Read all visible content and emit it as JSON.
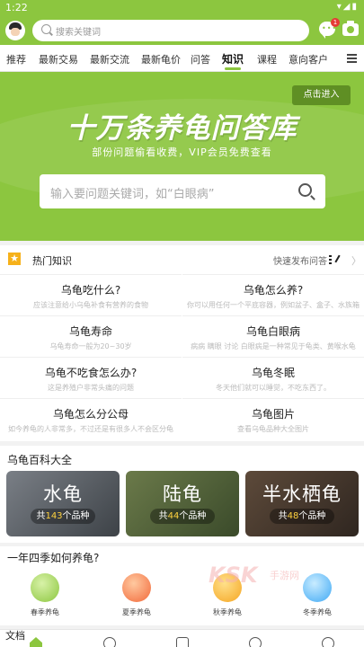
{
  "status_bar": {
    "time": "1:22",
    "icons": "▾◢▮"
  },
  "topbar": {
    "search_placeholder": "搜索关键词",
    "message_badge": "1"
  },
  "tabs": [
    {
      "label": "推荐"
    },
    {
      "label": "最新交易"
    },
    {
      "label": "最新交流"
    },
    {
      "label": "最新龟价"
    },
    {
      "label": "问答"
    },
    {
      "label": "知识",
      "active": true
    },
    {
      "label": "课程"
    },
    {
      "label": "意向客户"
    }
  ],
  "banner": {
    "cta_label": "点击进入",
    "title": "十万条养龟问答库",
    "subtitle": "部份问题偷看收费，VIP会员免费查看",
    "search_placeholder": "输入要问题关键词，如“白眼病”"
  },
  "hot_knowledge": {
    "title": "热门知识",
    "quick_ask": "快速发布问答",
    "items": [
      {
        "q": "乌龟吃什么?",
        "a": "应该注意给小乌龟补食有营养的食物"
      },
      {
        "q": "乌龟怎么养?",
        "a": "你可以用任何一个平底容器，例如盆子、盒子、水族箱"
      },
      {
        "q": "乌龟寿命",
        "a": "乌龟寿命一般为20~30岁"
      },
      {
        "q": "乌龟白眼病",
        "a": "病病 瞒眼 讨论 白眼病是一种常见于龟类、黄喉水龟"
      },
      {
        "q": "乌龟不吃食怎么办?",
        "a": "这是养殖户非常头痛的问题"
      },
      {
        "q": "乌龟冬眠",
        "a": "冬天他们就可以睡觉，不吃东西了。"
      },
      {
        "q": "乌龟怎么分公母",
        "a": "如今养龟的人非常多，不过还是有很多人不会区分龟"
      },
      {
        "q": "乌龟图片",
        "a": "查看乌龟品种大全图片"
      }
    ]
  },
  "encyclopedia": {
    "title": "乌龟百科大全",
    "cards": [
      {
        "name": "水龟",
        "prefix": "共",
        "count": "143",
        "suffix": "个品种"
      },
      {
        "name": "陆龟",
        "prefix": "共",
        "count": "44",
        "suffix": "个品种"
      },
      {
        "name": "半水栖龟",
        "prefix": "共",
        "count": "48",
        "suffix": "个品种"
      }
    ]
  },
  "seasons": {
    "title": "一年四季如何养龟?",
    "items": [
      {
        "label": "春季养龟"
      },
      {
        "label": "夏季养龟"
      },
      {
        "label": "秋季养龟"
      },
      {
        "label": "冬季养龟"
      }
    ]
  },
  "watermark": {
    "logo": "KSK",
    "text": "手游网"
  },
  "bottom_peek": "文档",
  "colors": {
    "primary": "#8cc63f",
    "cta": "#5f8f24",
    "accent_yellow": "#ffd23f",
    "star": "#f6b11a"
  }
}
